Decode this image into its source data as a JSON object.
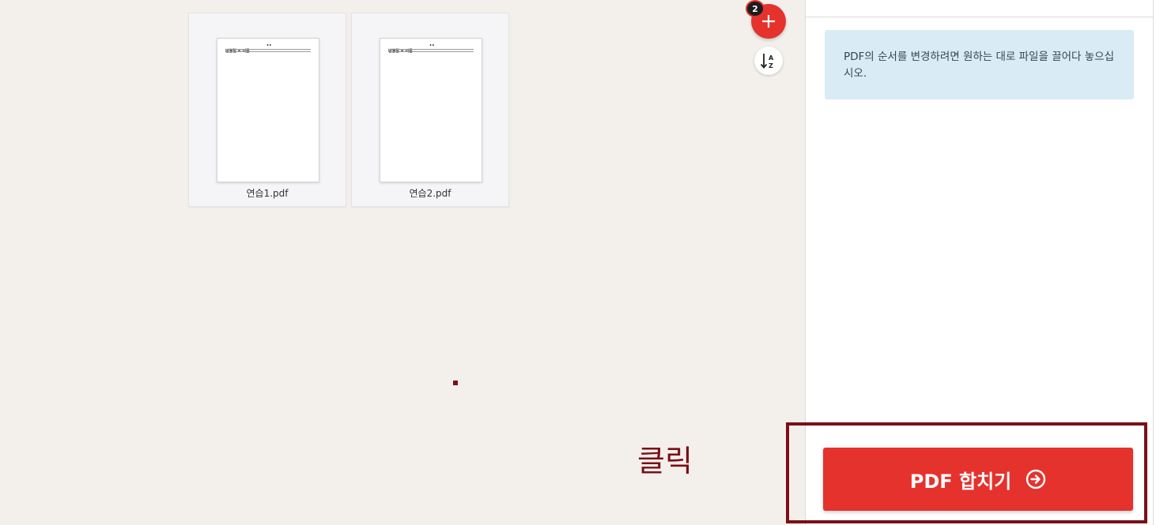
{
  "files": [
    {
      "name": "연습1.pdf",
      "preview_tag": "년월일 = 이름"
    },
    {
      "name": "연습2.pdf",
      "preview_tag": "년월일 = 이름"
    }
  ],
  "add_button": {
    "badge_count": "2",
    "icon": "plus-icon"
  },
  "sort_button": {
    "icon": "sort-az-icon"
  },
  "sidebar": {
    "info_text": "PDF의 순서를 변경하려면 원하는 대로 파일을 끌어다 놓으십시오.",
    "merge_label": "PDF 합치기",
    "merge_icon": "arrow-right-circle-icon"
  },
  "annotation": {
    "text": "클릭"
  },
  "colors": {
    "accent": "#e5322d",
    "annotation": "#7b0f17",
    "info_bg": "#d9ecf5"
  }
}
